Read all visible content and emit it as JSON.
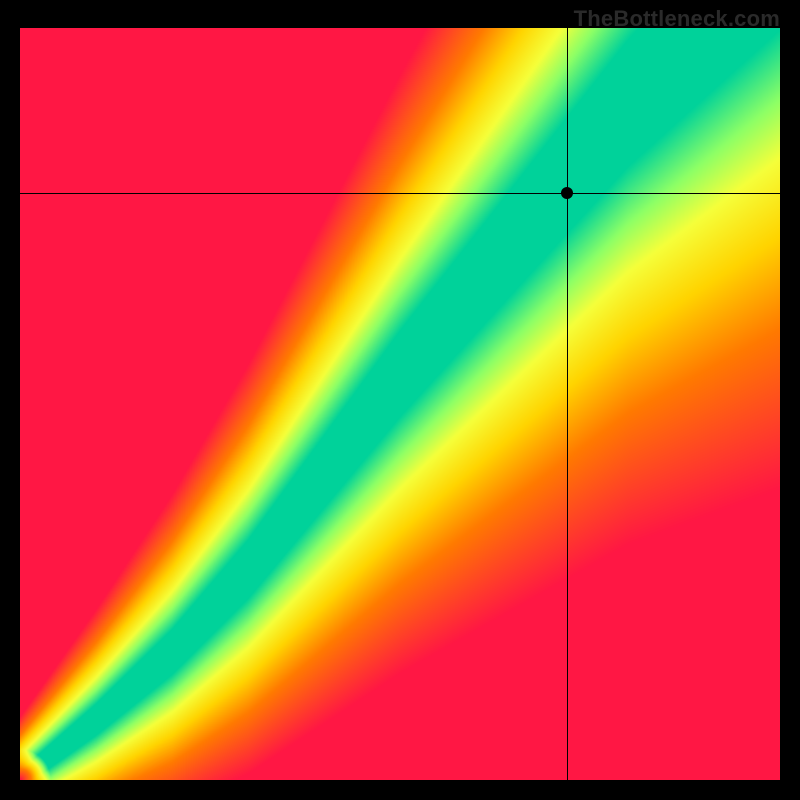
{
  "watermark": "TheBottleneck.com",
  "chart_data": {
    "type": "heatmap",
    "title": "",
    "xlabel": "",
    "ylabel": "",
    "xlim": [
      0,
      100
    ],
    "ylim": [
      0,
      100
    ],
    "marker": {
      "x": 72,
      "y": 78
    },
    "crosshair": {
      "x": 72,
      "y": 78
    },
    "optimal_curve": [
      {
        "x": 0,
        "y": 0
      },
      {
        "x": 10,
        "y": 8
      },
      {
        "x": 20,
        "y": 17
      },
      {
        "x": 30,
        "y": 28
      },
      {
        "x": 40,
        "y": 41
      },
      {
        "x": 50,
        "y": 54
      },
      {
        "x": 60,
        "y": 66
      },
      {
        "x": 70,
        "y": 78
      },
      {
        "x": 80,
        "y": 90
      },
      {
        "x": 90,
        "y": 100
      },
      {
        "x": 100,
        "y": 110
      }
    ],
    "color_stops": [
      {
        "t": 0.0,
        "color": "#ff1744"
      },
      {
        "t": 0.35,
        "color": "#ff7a00"
      },
      {
        "t": 0.55,
        "color": "#ffd400"
      },
      {
        "t": 0.72,
        "color": "#f5ff3a"
      },
      {
        "t": 0.85,
        "color": "#8cff66"
      },
      {
        "t": 1.0,
        "color": "#00d29a"
      }
    ],
    "band_halfwidth": 6.0,
    "falloff": 36.0
  }
}
